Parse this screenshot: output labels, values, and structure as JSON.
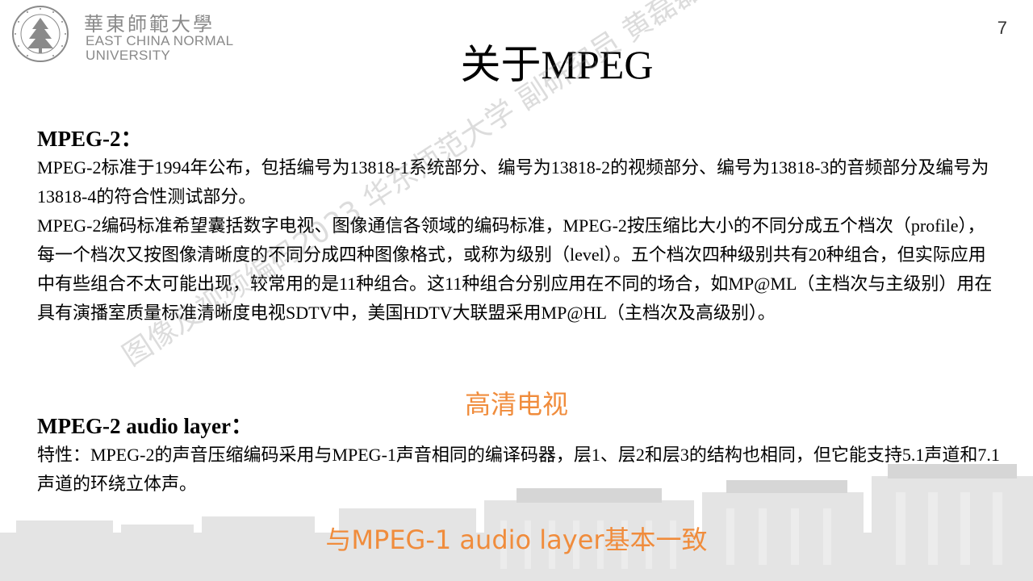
{
  "logo": {
    "cn_name": "華東師範大學",
    "en_line1": "EAST CHINA NORMAL",
    "en_line2": "UNIVERSITY"
  },
  "page_number": "7",
  "title": "关于MPEG",
  "section1": {
    "heading": "MPEG-2：",
    "paragraphs": [
      "MPEG-2标准于1994年公布，包括编号为13818-1系统部分、编号为13818-2的视频部分、编号为13818-3的音频部分及编号为13818-4的符合性测试部分。",
      "MPEG-2编码标准希望囊括数字电视、图像通信各领域的编码标准，MPEG-2按压缩比大小的不同分成五个档次（profile），每一个档次又按图像清晰度的不同分成四种图像格式，或称为级别（level）。五个档次四种级别共有20种组合，但实际应用中有些组合不太可能出现，较常用的是11种组合。这11种组合分别应用在不同的场合，如MP@ML（主档次与主级别）用在具有演播室质量标准清晰度电视SDTV中，美国HDTV大联盟采用MP@HL（主档次及高级别）。"
    ]
  },
  "note1": "高清电视",
  "section2": {
    "heading": "MPEG-2 audio layer：",
    "paragraph": "特性：MPEG-2的声音压缩编码采用与MPEG-1声音相同的编译码器，层1、层2和层3的结构也相同，但它能支持5.1声道和7.1声道的环绕立体声。"
  },
  "note2": "与MPEG-1 audio layer基本一致",
  "watermark": "图像及视频编码2023 华东师范大学 副研究员 黄磊磊",
  "colors": {
    "accent_orange": "#f08c3c",
    "logo_gray": "#8a8a8a"
  }
}
